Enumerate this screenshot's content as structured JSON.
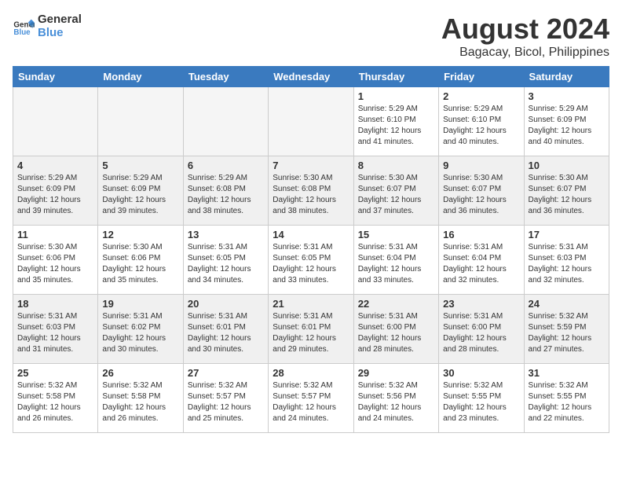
{
  "logo": {
    "line1": "General",
    "line2": "Blue"
  },
  "title": "August 2024",
  "subtitle": "Bagacay, Bicol, Philippines",
  "days_of_week": [
    "Sunday",
    "Monday",
    "Tuesday",
    "Wednesday",
    "Thursday",
    "Friday",
    "Saturday"
  ],
  "weeks": [
    [
      {
        "day": "",
        "info": "",
        "empty": true
      },
      {
        "day": "",
        "info": "",
        "empty": true
      },
      {
        "day": "",
        "info": "",
        "empty": true
      },
      {
        "day": "",
        "info": "",
        "empty": true
      },
      {
        "day": "1",
        "info": "Sunrise: 5:29 AM\nSunset: 6:10 PM\nDaylight: 12 hours\nand 41 minutes."
      },
      {
        "day": "2",
        "info": "Sunrise: 5:29 AM\nSunset: 6:10 PM\nDaylight: 12 hours\nand 40 minutes."
      },
      {
        "day": "3",
        "info": "Sunrise: 5:29 AM\nSunset: 6:09 PM\nDaylight: 12 hours\nand 40 minutes."
      }
    ],
    [
      {
        "day": "4",
        "info": "Sunrise: 5:29 AM\nSunset: 6:09 PM\nDaylight: 12 hours\nand 39 minutes."
      },
      {
        "day": "5",
        "info": "Sunrise: 5:29 AM\nSunset: 6:09 PM\nDaylight: 12 hours\nand 39 minutes."
      },
      {
        "day": "6",
        "info": "Sunrise: 5:29 AM\nSunset: 6:08 PM\nDaylight: 12 hours\nand 38 minutes."
      },
      {
        "day": "7",
        "info": "Sunrise: 5:30 AM\nSunset: 6:08 PM\nDaylight: 12 hours\nand 38 minutes."
      },
      {
        "day": "8",
        "info": "Sunrise: 5:30 AM\nSunset: 6:07 PM\nDaylight: 12 hours\nand 37 minutes."
      },
      {
        "day": "9",
        "info": "Sunrise: 5:30 AM\nSunset: 6:07 PM\nDaylight: 12 hours\nand 36 minutes."
      },
      {
        "day": "10",
        "info": "Sunrise: 5:30 AM\nSunset: 6:07 PM\nDaylight: 12 hours\nand 36 minutes."
      }
    ],
    [
      {
        "day": "11",
        "info": "Sunrise: 5:30 AM\nSunset: 6:06 PM\nDaylight: 12 hours\nand 35 minutes."
      },
      {
        "day": "12",
        "info": "Sunrise: 5:30 AM\nSunset: 6:06 PM\nDaylight: 12 hours\nand 35 minutes."
      },
      {
        "day": "13",
        "info": "Sunrise: 5:31 AM\nSunset: 6:05 PM\nDaylight: 12 hours\nand 34 minutes."
      },
      {
        "day": "14",
        "info": "Sunrise: 5:31 AM\nSunset: 6:05 PM\nDaylight: 12 hours\nand 33 minutes."
      },
      {
        "day": "15",
        "info": "Sunrise: 5:31 AM\nSunset: 6:04 PM\nDaylight: 12 hours\nand 33 minutes."
      },
      {
        "day": "16",
        "info": "Sunrise: 5:31 AM\nSunset: 6:04 PM\nDaylight: 12 hours\nand 32 minutes."
      },
      {
        "day": "17",
        "info": "Sunrise: 5:31 AM\nSunset: 6:03 PM\nDaylight: 12 hours\nand 32 minutes."
      }
    ],
    [
      {
        "day": "18",
        "info": "Sunrise: 5:31 AM\nSunset: 6:03 PM\nDaylight: 12 hours\nand 31 minutes."
      },
      {
        "day": "19",
        "info": "Sunrise: 5:31 AM\nSunset: 6:02 PM\nDaylight: 12 hours\nand 30 minutes."
      },
      {
        "day": "20",
        "info": "Sunrise: 5:31 AM\nSunset: 6:01 PM\nDaylight: 12 hours\nand 30 minutes."
      },
      {
        "day": "21",
        "info": "Sunrise: 5:31 AM\nSunset: 6:01 PM\nDaylight: 12 hours\nand 29 minutes."
      },
      {
        "day": "22",
        "info": "Sunrise: 5:31 AM\nSunset: 6:00 PM\nDaylight: 12 hours\nand 28 minutes."
      },
      {
        "day": "23",
        "info": "Sunrise: 5:31 AM\nSunset: 6:00 PM\nDaylight: 12 hours\nand 28 minutes."
      },
      {
        "day": "24",
        "info": "Sunrise: 5:32 AM\nSunset: 5:59 PM\nDaylight: 12 hours\nand 27 minutes."
      }
    ],
    [
      {
        "day": "25",
        "info": "Sunrise: 5:32 AM\nSunset: 5:58 PM\nDaylight: 12 hours\nand 26 minutes."
      },
      {
        "day": "26",
        "info": "Sunrise: 5:32 AM\nSunset: 5:58 PM\nDaylight: 12 hours\nand 26 minutes."
      },
      {
        "day": "27",
        "info": "Sunrise: 5:32 AM\nSunset: 5:57 PM\nDaylight: 12 hours\nand 25 minutes."
      },
      {
        "day": "28",
        "info": "Sunrise: 5:32 AM\nSunset: 5:57 PM\nDaylight: 12 hours\nand 24 minutes."
      },
      {
        "day": "29",
        "info": "Sunrise: 5:32 AM\nSunset: 5:56 PM\nDaylight: 12 hours\nand 24 minutes."
      },
      {
        "day": "30",
        "info": "Sunrise: 5:32 AM\nSunset: 5:55 PM\nDaylight: 12 hours\nand 23 minutes."
      },
      {
        "day": "31",
        "info": "Sunrise: 5:32 AM\nSunset: 5:55 PM\nDaylight: 12 hours\nand 22 minutes."
      }
    ]
  ]
}
